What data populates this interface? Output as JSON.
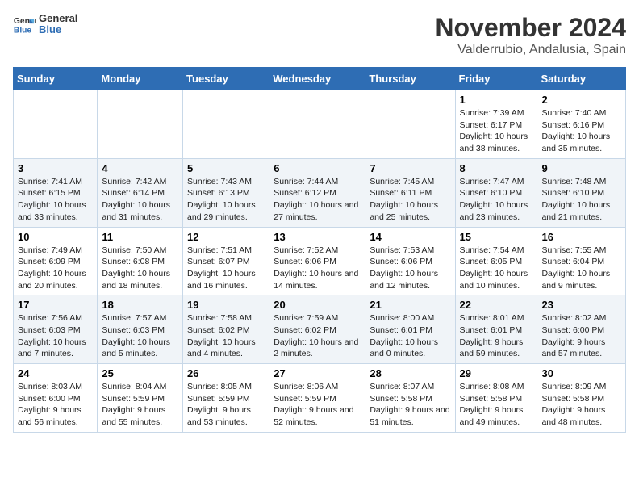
{
  "app": {
    "logo_general": "General",
    "logo_blue": "Blue",
    "title": "November 2024",
    "subtitle": "Valderrubio, Andalusia, Spain"
  },
  "calendar": {
    "headers": [
      "Sunday",
      "Monday",
      "Tuesday",
      "Wednesday",
      "Thursday",
      "Friday",
      "Saturday"
    ],
    "rows": [
      [
        {
          "day": "",
          "sunrise": "",
          "sunset": "",
          "daylight": ""
        },
        {
          "day": "",
          "sunrise": "",
          "sunset": "",
          "daylight": ""
        },
        {
          "day": "",
          "sunrise": "",
          "sunset": "",
          "daylight": ""
        },
        {
          "day": "",
          "sunrise": "",
          "sunset": "",
          "daylight": ""
        },
        {
          "day": "",
          "sunrise": "",
          "sunset": "",
          "daylight": ""
        },
        {
          "day": "1",
          "sunrise": "Sunrise: 7:39 AM",
          "sunset": "Sunset: 6:17 PM",
          "daylight": "Daylight: 10 hours and 38 minutes."
        },
        {
          "day": "2",
          "sunrise": "Sunrise: 7:40 AM",
          "sunset": "Sunset: 6:16 PM",
          "daylight": "Daylight: 10 hours and 35 minutes."
        }
      ],
      [
        {
          "day": "3",
          "sunrise": "Sunrise: 7:41 AM",
          "sunset": "Sunset: 6:15 PM",
          "daylight": "Daylight: 10 hours and 33 minutes."
        },
        {
          "day": "4",
          "sunrise": "Sunrise: 7:42 AM",
          "sunset": "Sunset: 6:14 PM",
          "daylight": "Daylight: 10 hours and 31 minutes."
        },
        {
          "day": "5",
          "sunrise": "Sunrise: 7:43 AM",
          "sunset": "Sunset: 6:13 PM",
          "daylight": "Daylight: 10 hours and 29 minutes."
        },
        {
          "day": "6",
          "sunrise": "Sunrise: 7:44 AM",
          "sunset": "Sunset: 6:12 PM",
          "daylight": "Daylight: 10 hours and 27 minutes."
        },
        {
          "day": "7",
          "sunrise": "Sunrise: 7:45 AM",
          "sunset": "Sunset: 6:11 PM",
          "daylight": "Daylight: 10 hours and 25 minutes."
        },
        {
          "day": "8",
          "sunrise": "Sunrise: 7:47 AM",
          "sunset": "Sunset: 6:10 PM",
          "daylight": "Daylight: 10 hours and 23 minutes."
        },
        {
          "day": "9",
          "sunrise": "Sunrise: 7:48 AM",
          "sunset": "Sunset: 6:10 PM",
          "daylight": "Daylight: 10 hours and 21 minutes."
        }
      ],
      [
        {
          "day": "10",
          "sunrise": "Sunrise: 7:49 AM",
          "sunset": "Sunset: 6:09 PM",
          "daylight": "Daylight: 10 hours and 20 minutes."
        },
        {
          "day": "11",
          "sunrise": "Sunrise: 7:50 AM",
          "sunset": "Sunset: 6:08 PM",
          "daylight": "Daylight: 10 hours and 18 minutes."
        },
        {
          "day": "12",
          "sunrise": "Sunrise: 7:51 AM",
          "sunset": "Sunset: 6:07 PM",
          "daylight": "Daylight: 10 hours and 16 minutes."
        },
        {
          "day": "13",
          "sunrise": "Sunrise: 7:52 AM",
          "sunset": "Sunset: 6:06 PM",
          "daylight": "Daylight: 10 hours and 14 minutes."
        },
        {
          "day": "14",
          "sunrise": "Sunrise: 7:53 AM",
          "sunset": "Sunset: 6:06 PM",
          "daylight": "Daylight: 10 hours and 12 minutes."
        },
        {
          "day": "15",
          "sunrise": "Sunrise: 7:54 AM",
          "sunset": "Sunset: 6:05 PM",
          "daylight": "Daylight: 10 hours and 10 minutes."
        },
        {
          "day": "16",
          "sunrise": "Sunrise: 7:55 AM",
          "sunset": "Sunset: 6:04 PM",
          "daylight": "Daylight: 10 hours and 9 minutes."
        }
      ],
      [
        {
          "day": "17",
          "sunrise": "Sunrise: 7:56 AM",
          "sunset": "Sunset: 6:03 PM",
          "daylight": "Daylight: 10 hours and 7 minutes."
        },
        {
          "day": "18",
          "sunrise": "Sunrise: 7:57 AM",
          "sunset": "Sunset: 6:03 PM",
          "daylight": "Daylight: 10 hours and 5 minutes."
        },
        {
          "day": "19",
          "sunrise": "Sunrise: 7:58 AM",
          "sunset": "Sunset: 6:02 PM",
          "daylight": "Daylight: 10 hours and 4 minutes."
        },
        {
          "day": "20",
          "sunrise": "Sunrise: 7:59 AM",
          "sunset": "Sunset: 6:02 PM",
          "daylight": "Daylight: 10 hours and 2 minutes."
        },
        {
          "day": "21",
          "sunrise": "Sunrise: 8:00 AM",
          "sunset": "Sunset: 6:01 PM",
          "daylight": "Daylight: 10 hours and 0 minutes."
        },
        {
          "day": "22",
          "sunrise": "Sunrise: 8:01 AM",
          "sunset": "Sunset: 6:01 PM",
          "daylight": "Daylight: 9 hours and 59 minutes."
        },
        {
          "day": "23",
          "sunrise": "Sunrise: 8:02 AM",
          "sunset": "Sunset: 6:00 PM",
          "daylight": "Daylight: 9 hours and 57 minutes."
        }
      ],
      [
        {
          "day": "24",
          "sunrise": "Sunrise: 8:03 AM",
          "sunset": "Sunset: 6:00 PM",
          "daylight": "Daylight: 9 hours and 56 minutes."
        },
        {
          "day": "25",
          "sunrise": "Sunrise: 8:04 AM",
          "sunset": "Sunset: 5:59 PM",
          "daylight": "Daylight: 9 hours and 55 minutes."
        },
        {
          "day": "26",
          "sunrise": "Sunrise: 8:05 AM",
          "sunset": "Sunset: 5:59 PM",
          "daylight": "Daylight: 9 hours and 53 minutes."
        },
        {
          "day": "27",
          "sunrise": "Sunrise: 8:06 AM",
          "sunset": "Sunset: 5:59 PM",
          "daylight": "Daylight: 9 hours and 52 minutes."
        },
        {
          "day": "28",
          "sunrise": "Sunrise: 8:07 AM",
          "sunset": "Sunset: 5:58 PM",
          "daylight": "Daylight: 9 hours and 51 minutes."
        },
        {
          "day": "29",
          "sunrise": "Sunrise: 8:08 AM",
          "sunset": "Sunset: 5:58 PM",
          "daylight": "Daylight: 9 hours and 49 minutes."
        },
        {
          "day": "30",
          "sunrise": "Sunrise: 8:09 AM",
          "sunset": "Sunset: 5:58 PM",
          "daylight": "Daylight: 9 hours and 48 minutes."
        }
      ]
    ]
  }
}
